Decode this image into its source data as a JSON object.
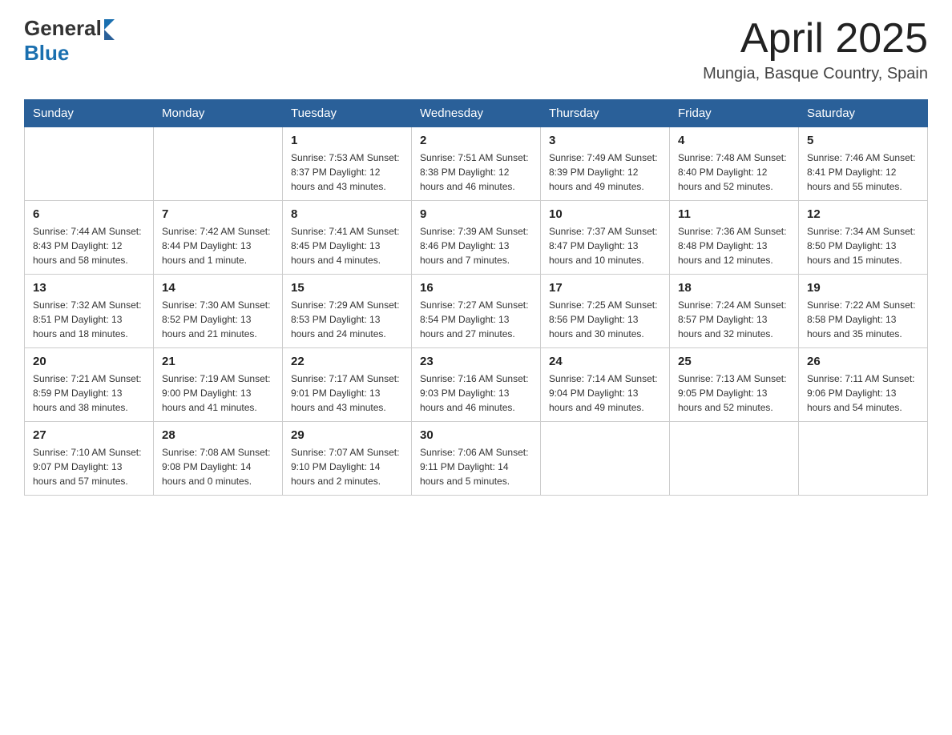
{
  "header": {
    "logo_general": "General",
    "logo_blue": "Blue",
    "month_title": "April 2025",
    "location": "Mungia, Basque Country, Spain"
  },
  "days_of_week": [
    "Sunday",
    "Monday",
    "Tuesday",
    "Wednesday",
    "Thursday",
    "Friday",
    "Saturday"
  ],
  "weeks": [
    [
      {
        "day": "",
        "info": ""
      },
      {
        "day": "",
        "info": ""
      },
      {
        "day": "1",
        "info": "Sunrise: 7:53 AM\nSunset: 8:37 PM\nDaylight: 12 hours\nand 43 minutes."
      },
      {
        "day": "2",
        "info": "Sunrise: 7:51 AM\nSunset: 8:38 PM\nDaylight: 12 hours\nand 46 minutes."
      },
      {
        "day": "3",
        "info": "Sunrise: 7:49 AM\nSunset: 8:39 PM\nDaylight: 12 hours\nand 49 minutes."
      },
      {
        "day": "4",
        "info": "Sunrise: 7:48 AM\nSunset: 8:40 PM\nDaylight: 12 hours\nand 52 minutes."
      },
      {
        "day": "5",
        "info": "Sunrise: 7:46 AM\nSunset: 8:41 PM\nDaylight: 12 hours\nand 55 minutes."
      }
    ],
    [
      {
        "day": "6",
        "info": "Sunrise: 7:44 AM\nSunset: 8:43 PM\nDaylight: 12 hours\nand 58 minutes."
      },
      {
        "day": "7",
        "info": "Sunrise: 7:42 AM\nSunset: 8:44 PM\nDaylight: 13 hours\nand 1 minute."
      },
      {
        "day": "8",
        "info": "Sunrise: 7:41 AM\nSunset: 8:45 PM\nDaylight: 13 hours\nand 4 minutes."
      },
      {
        "day": "9",
        "info": "Sunrise: 7:39 AM\nSunset: 8:46 PM\nDaylight: 13 hours\nand 7 minutes."
      },
      {
        "day": "10",
        "info": "Sunrise: 7:37 AM\nSunset: 8:47 PM\nDaylight: 13 hours\nand 10 minutes."
      },
      {
        "day": "11",
        "info": "Sunrise: 7:36 AM\nSunset: 8:48 PM\nDaylight: 13 hours\nand 12 minutes."
      },
      {
        "day": "12",
        "info": "Sunrise: 7:34 AM\nSunset: 8:50 PM\nDaylight: 13 hours\nand 15 minutes."
      }
    ],
    [
      {
        "day": "13",
        "info": "Sunrise: 7:32 AM\nSunset: 8:51 PM\nDaylight: 13 hours\nand 18 minutes."
      },
      {
        "day": "14",
        "info": "Sunrise: 7:30 AM\nSunset: 8:52 PM\nDaylight: 13 hours\nand 21 minutes."
      },
      {
        "day": "15",
        "info": "Sunrise: 7:29 AM\nSunset: 8:53 PM\nDaylight: 13 hours\nand 24 minutes."
      },
      {
        "day": "16",
        "info": "Sunrise: 7:27 AM\nSunset: 8:54 PM\nDaylight: 13 hours\nand 27 minutes."
      },
      {
        "day": "17",
        "info": "Sunrise: 7:25 AM\nSunset: 8:56 PM\nDaylight: 13 hours\nand 30 minutes."
      },
      {
        "day": "18",
        "info": "Sunrise: 7:24 AM\nSunset: 8:57 PM\nDaylight: 13 hours\nand 32 minutes."
      },
      {
        "day": "19",
        "info": "Sunrise: 7:22 AM\nSunset: 8:58 PM\nDaylight: 13 hours\nand 35 minutes."
      }
    ],
    [
      {
        "day": "20",
        "info": "Sunrise: 7:21 AM\nSunset: 8:59 PM\nDaylight: 13 hours\nand 38 minutes."
      },
      {
        "day": "21",
        "info": "Sunrise: 7:19 AM\nSunset: 9:00 PM\nDaylight: 13 hours\nand 41 minutes."
      },
      {
        "day": "22",
        "info": "Sunrise: 7:17 AM\nSunset: 9:01 PM\nDaylight: 13 hours\nand 43 minutes."
      },
      {
        "day": "23",
        "info": "Sunrise: 7:16 AM\nSunset: 9:03 PM\nDaylight: 13 hours\nand 46 minutes."
      },
      {
        "day": "24",
        "info": "Sunrise: 7:14 AM\nSunset: 9:04 PM\nDaylight: 13 hours\nand 49 minutes."
      },
      {
        "day": "25",
        "info": "Sunrise: 7:13 AM\nSunset: 9:05 PM\nDaylight: 13 hours\nand 52 minutes."
      },
      {
        "day": "26",
        "info": "Sunrise: 7:11 AM\nSunset: 9:06 PM\nDaylight: 13 hours\nand 54 minutes."
      }
    ],
    [
      {
        "day": "27",
        "info": "Sunrise: 7:10 AM\nSunset: 9:07 PM\nDaylight: 13 hours\nand 57 minutes."
      },
      {
        "day": "28",
        "info": "Sunrise: 7:08 AM\nSunset: 9:08 PM\nDaylight: 14 hours\nand 0 minutes."
      },
      {
        "day": "29",
        "info": "Sunrise: 7:07 AM\nSunset: 9:10 PM\nDaylight: 14 hours\nand 2 minutes."
      },
      {
        "day": "30",
        "info": "Sunrise: 7:06 AM\nSunset: 9:11 PM\nDaylight: 14 hours\nand 5 minutes."
      },
      {
        "day": "",
        "info": ""
      },
      {
        "day": "",
        "info": ""
      },
      {
        "day": "",
        "info": ""
      }
    ]
  ]
}
